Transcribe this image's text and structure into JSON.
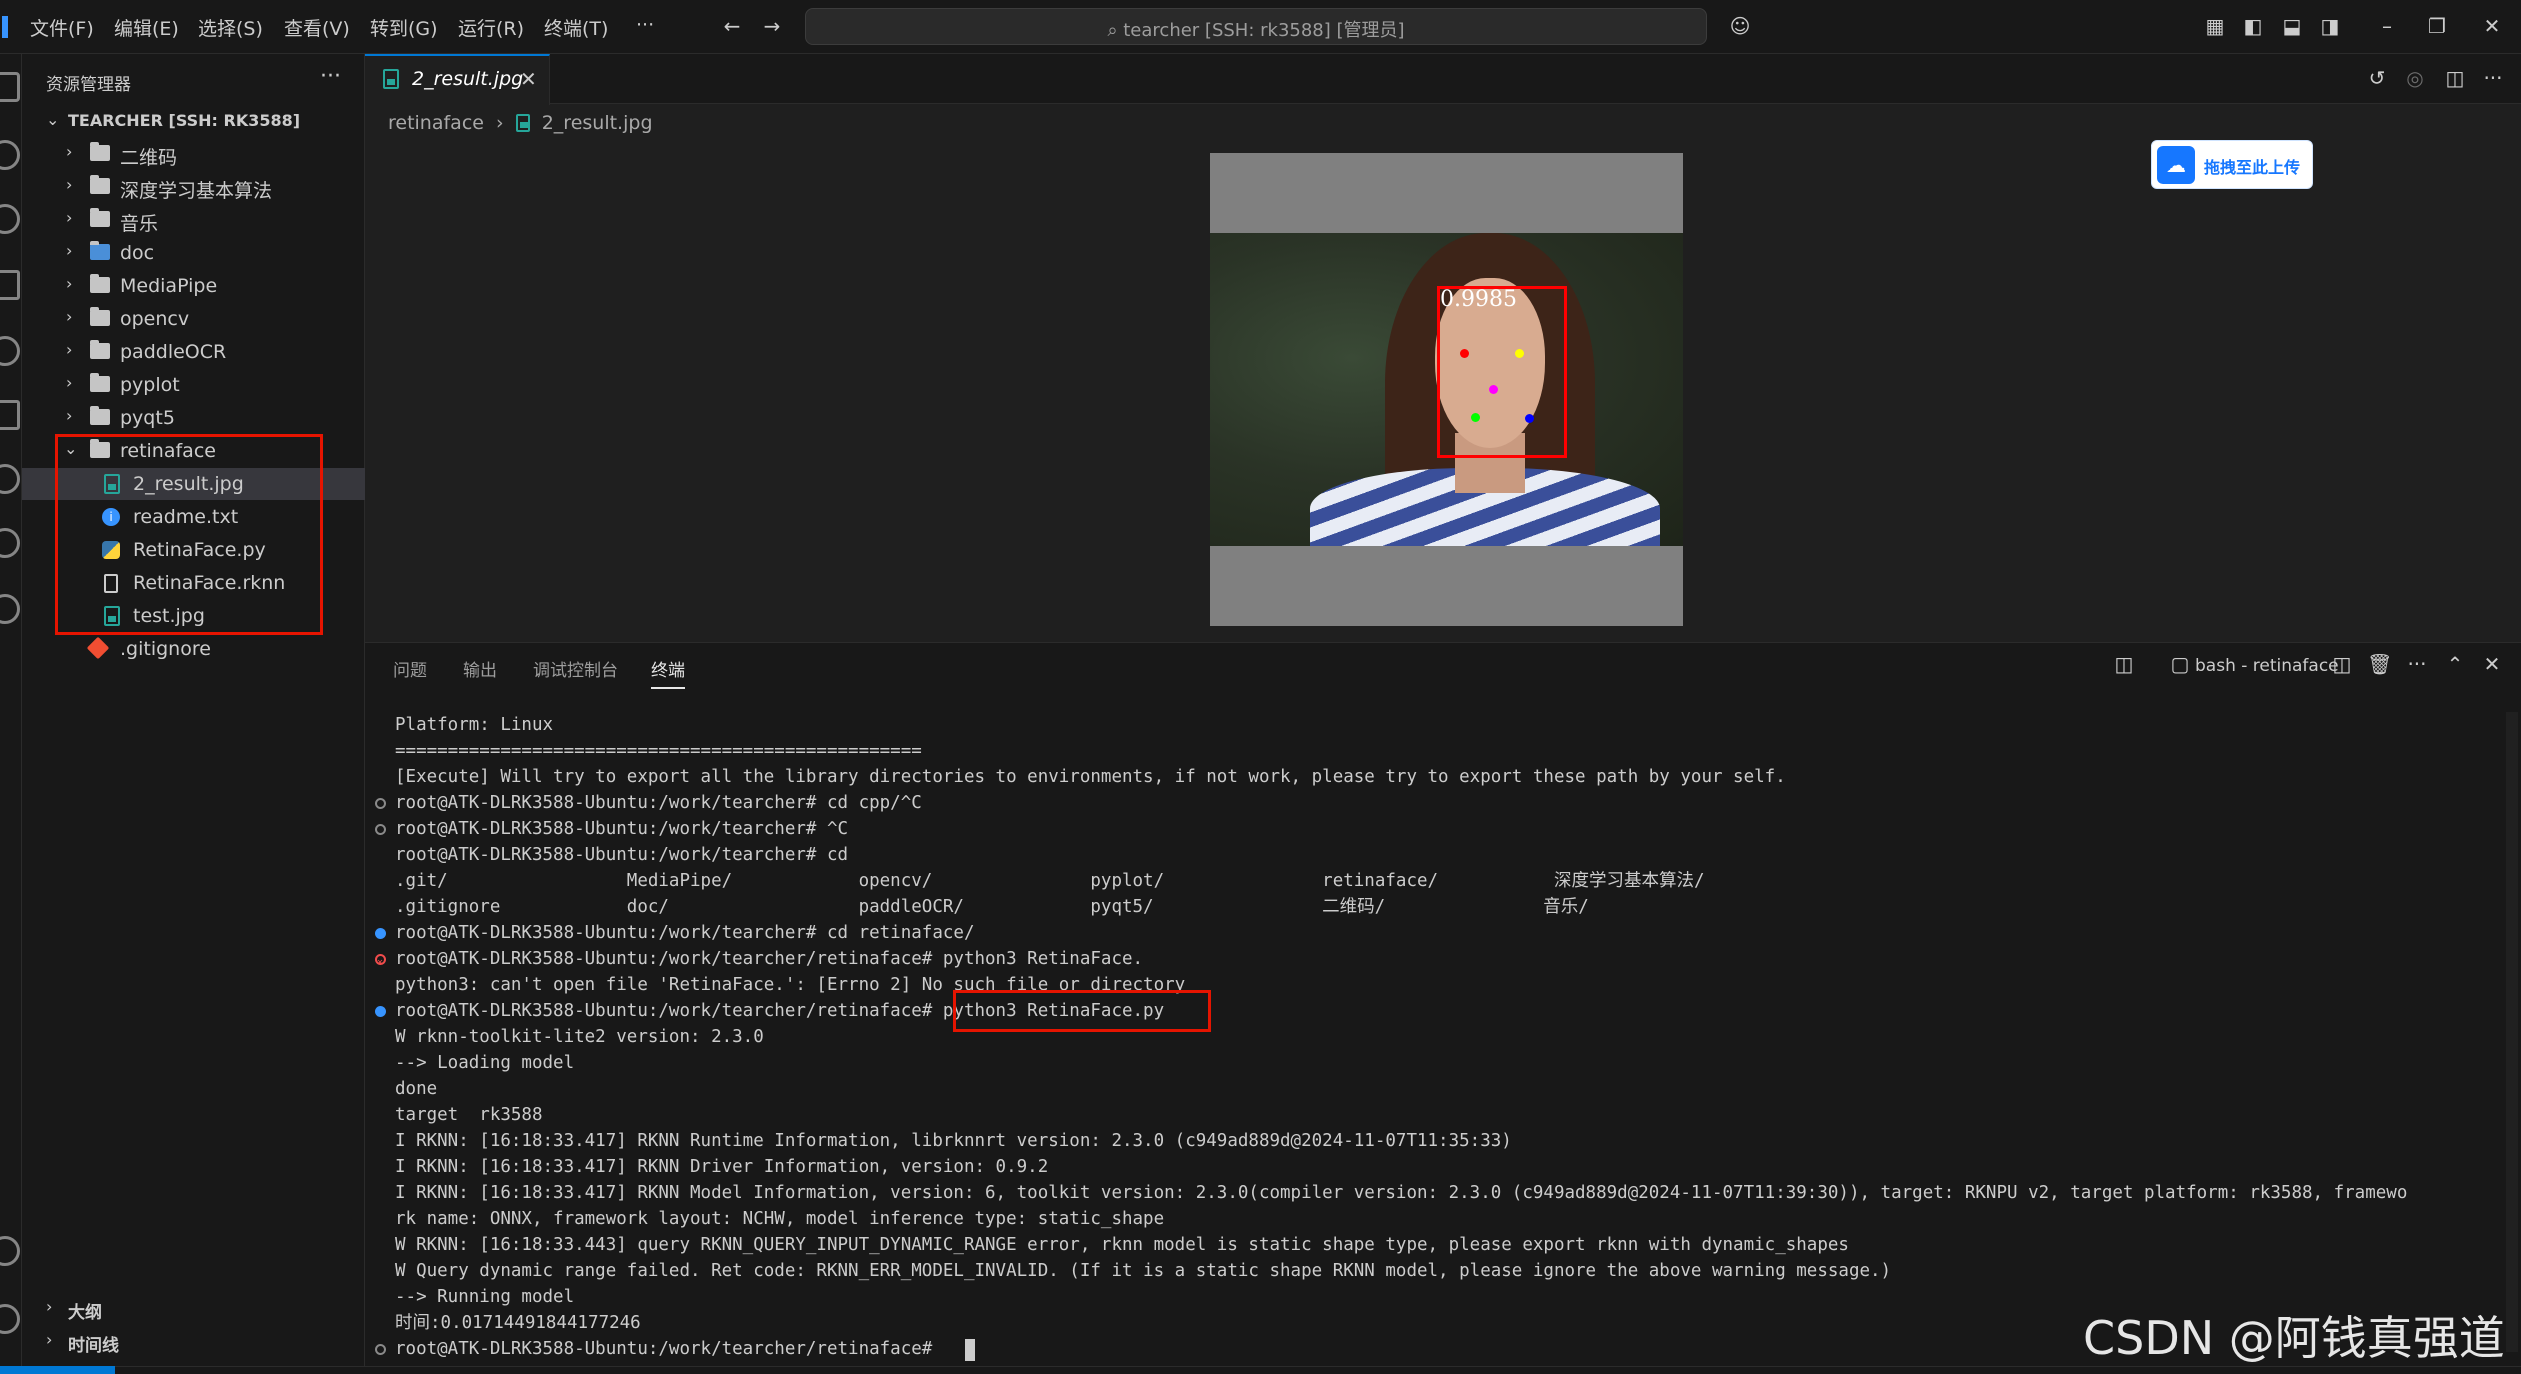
{
  "menu": [
    "文件(F)",
    "编辑(E)",
    "选择(S)",
    "查看(V)",
    "转到(G)",
    "运行(R)",
    "终端(T)",
    "···"
  ],
  "search": {
    "text": "tearcher [SSH: rk3588] [管理员]"
  },
  "explorer": {
    "title": "资源管理器",
    "more": "···",
    "root": "TEARCHER [SSH: RK3588]",
    "folders": [
      "二维码",
      "深度学习基本算法",
      "音乐",
      "doc",
      "MediaPipe",
      "opencv",
      "paddleOCR",
      "pyplot",
      "pyqt5",
      "retinaface"
    ],
    "retinaface_files": [
      "2_result.jpg",
      "readme.txt",
      "RetinaFace.py",
      "RetinaFace.rknn",
      "test.jpg"
    ],
    "gitignore": ".gitignore",
    "outline": "大纲",
    "timeline": "时间线"
  },
  "editor": {
    "tab_label": "2_result.jpg",
    "breadcrumb_folder": "retinaface",
    "breadcrumb_file": "2_result.jpg",
    "upload_label": "拖拽至此上传",
    "detection_score": "0.9985"
  },
  "panel": {
    "tabs": [
      "问题",
      "输出",
      "调试控制台",
      "终端"
    ],
    "terminal_name": "bash - retinaface"
  },
  "terminal_lines": [
    {
      "text": "Platform: Linux",
      "dot": ""
    },
    {
      "text": "==================================================",
      "dot": ""
    },
    {
      "text": "[Execute] Will try to export all the library directories to environments, if not work, please try to export these path by your self.",
      "dot": ""
    },
    {
      "text": "root@ATK-DLRK3588-Ubuntu:/work/tearcher# cd cpp/^C",
      "dot": "hollow"
    },
    {
      "text": "root@ATK-DLRK3588-Ubuntu:/work/tearcher# ^C",
      "dot": "hollow"
    },
    {
      "text": "root@ATK-DLRK3588-Ubuntu:/work/tearcher# cd",
      "dot": ""
    },
    {
      "text": ".git/                 MediaPipe/            opencv/               pyplot/               retinaface/           深度学习基本算法/",
      "dot": ""
    },
    {
      "text": ".gitignore            doc/                  paddleOCR/            pyqt5/                二维码/               音乐/",
      "dot": ""
    },
    {
      "text": "root@ATK-DLRK3588-Ubuntu:/work/tearcher# cd retinaface/",
      "dot": "blue"
    },
    {
      "text": "root@ATK-DLRK3588-Ubuntu:/work/tearcher/retinaface# python3 RetinaFace.",
      "dot": "red"
    },
    {
      "text": "python3: can't open file 'RetinaFace.': [Errno 2] No such file or directory",
      "dot": ""
    },
    {
      "text": "root@ATK-DLRK3588-Ubuntu:/work/tearcher/retinaface# python3 RetinaFace.py",
      "dot": "blue"
    },
    {
      "text": "W rknn-toolkit-lite2 version: 2.3.0",
      "dot": ""
    },
    {
      "text": "--> Loading model",
      "dot": ""
    },
    {
      "text": "done",
      "dot": ""
    },
    {
      "text": "target  rk3588",
      "dot": ""
    },
    {
      "text": "I RKNN: [16:18:33.417] RKNN Runtime Information, librknnrt version: 2.3.0 (c949ad889d@2024-11-07T11:35:33)",
      "dot": ""
    },
    {
      "text": "I RKNN: [16:18:33.417] RKNN Driver Information, version: 0.9.2",
      "dot": ""
    },
    {
      "text": "I RKNN: [16:18:33.417] RKNN Model Information, version: 6, toolkit version: 2.3.0(compiler version: 2.3.0 (c949ad889d@2024-11-07T11:39:30)), target: RKNPU v2, target platform: rk3588, framewo",
      "dot": ""
    },
    {
      "text": "rk name: ONNX, framework layout: NCHW, model inference type: static_shape",
      "dot": ""
    },
    {
      "text": "W RKNN: [16:18:33.443] query RKNN_QUERY_INPUT_DYNAMIC_RANGE error, rknn model is static shape type, please export rknn with dynamic_shapes",
      "dot": ""
    },
    {
      "text": "W Query dynamic range failed. Ret code: RKNN_ERR_MODEL_INVALID. (If it is a static shape RKNN model, please ignore the above warning message.)",
      "dot": ""
    },
    {
      "text": "--> Running model",
      "dot": ""
    },
    {
      "text": "时间:0.01714491844177246",
      "dot": ""
    },
    {
      "text": "root@ATK-DLRK3588-Ubuntu:/work/tearcher/retinaface# ",
      "dot": "hollow"
    }
  ],
  "watermark": "CSDN @阿钱真强道",
  "colors": {
    "accent": "#0078d4",
    "highlight": "#e51400",
    "box": "#ff0000"
  }
}
